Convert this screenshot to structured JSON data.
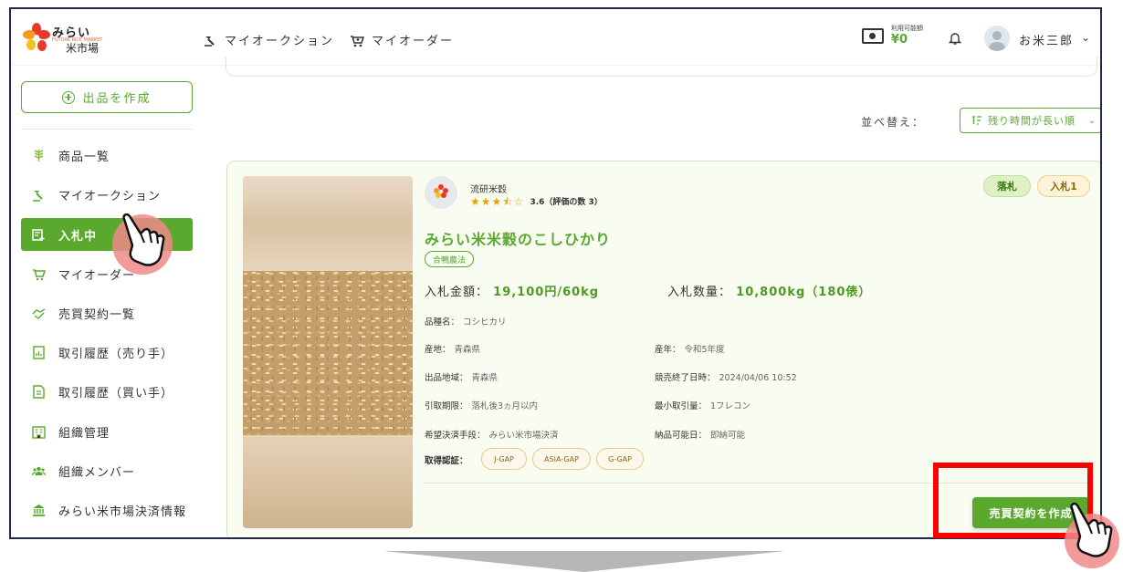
{
  "header": {
    "logo_text": "みらい",
    "logo_sub": "FUTURE RICE MARKET",
    "logo_text2": "米市場",
    "nav_auction": "マイオークション",
    "nav_order": "マイオーダー",
    "wallet_label": "利用可能額",
    "wallet_amount": "¥0",
    "user_name": "お米三郎",
    "user_chevron": "⌄"
  },
  "sidebar": {
    "create_label": "出品を作成",
    "items": [
      {
        "label": "商品一覧",
        "icon": "rice-plant-icon"
      },
      {
        "label": "マイオークション",
        "icon": "auction-hammer-icon"
      },
      {
        "label": "入札中",
        "icon": "bidding-icon"
      },
      {
        "label": "マイオーダー",
        "icon": "cart-plus-icon"
      },
      {
        "label": "売買契約一覧",
        "icon": "handshake-icon"
      },
      {
        "label": "取引履歴（売り手）",
        "icon": "document-chart-icon"
      },
      {
        "label": "取引履歴（買い手）",
        "icon": "document-icon"
      },
      {
        "label": "組織管理",
        "icon": "building-icon"
      },
      {
        "label": "組織メンバー",
        "icon": "members-icon"
      },
      {
        "label": "みらい米市場決済情報",
        "icon": "bank-icon"
      }
    ]
  },
  "sort": {
    "label": "並べ替え：",
    "value": "残り時間が長い順",
    "chevron": "⌄"
  },
  "card": {
    "seller_name": "流研米穀",
    "rating": 3.5,
    "rating_text": "3.6（評価の数 3）",
    "badge_won": "落札",
    "badge_bid": "入札1",
    "title": "みらい米米穀のこしひかり",
    "tag": "合鴨農法",
    "bid_amount_label": "入札金額：",
    "bid_amount": "19,100円/60kg",
    "bid_qty_label": "入札数量：",
    "bid_qty": "10,800kg（180俵）",
    "variety_label": "品種名：",
    "variety": "コシヒカリ",
    "origin_label": "産地：",
    "origin": "青森県",
    "year_label": "産年：",
    "year": "令和5年度",
    "region_label": "出品地域：",
    "region": "青森県",
    "end_label": "競売終了日時：",
    "end": "2024/04/06 10:52",
    "pickup_label": "引取期限：",
    "pickup": "落札後3ヵ月以内",
    "min_label": "最小取引量：",
    "min": "1フレコン",
    "payment_label": "希望決済手段：",
    "payment": "みらい米市場決済",
    "delivery_label": "納品可能日：",
    "delivery": "即納可能",
    "cert_label": "取得認証：",
    "certs": [
      "J-GAP",
      "ASIA-GAP",
      "G-GAP"
    ],
    "contract_button": "売買契約を作成"
  },
  "colors": {
    "accent": "#5aa92e",
    "highlight": "#ff0000"
  }
}
